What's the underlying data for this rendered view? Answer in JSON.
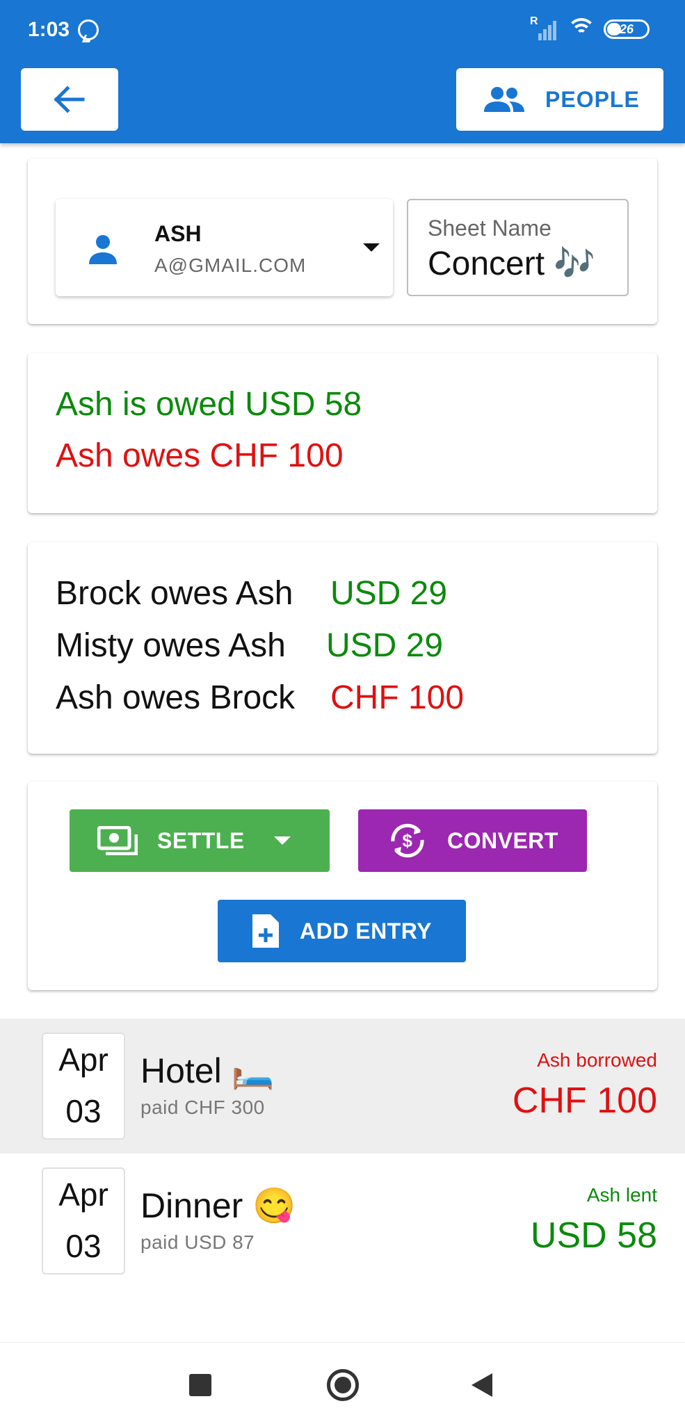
{
  "status_bar": {
    "time": "1:03",
    "signal_label": "R",
    "battery": "26",
    "icons": [
      "whatsapp-icon",
      "signal-icon",
      "wifi-icon",
      "battery-icon"
    ]
  },
  "app_bar": {
    "back_icon": "arrow-left-icon",
    "people_label": "PEOPLE",
    "people_icon": "people-icon",
    "color": "#1976d2"
  },
  "selector": {
    "user_name": "ASH",
    "user_email": "A@GMAIL.COM",
    "user_icon": "person-icon",
    "sheet_label": "Sheet Name",
    "sheet_value": "Concert 🎶"
  },
  "summary": {
    "owed": "Ash is owed USD 58",
    "owes": "Ash owes CHF 100"
  },
  "debts": [
    {
      "text": "Brock owes Ash",
      "amount": "USD 29",
      "status": "green"
    },
    {
      "text": "Misty owes Ash",
      "amount": "USD 29",
      "status": "green"
    },
    {
      "text": "Ash owes Brock",
      "amount": "CHF 100",
      "status": "red"
    }
  ],
  "actions": {
    "settle": "SETTLE",
    "convert": "CONVERT",
    "add_entry": "ADD ENTRY",
    "settle_color": "#4caf50",
    "convert_color": "#9c27b0",
    "add_color": "#1976d2"
  },
  "entries": [
    {
      "month": "Apr",
      "day": "03",
      "title": "Hotel 🛏️",
      "paid": "paid CHF 300",
      "role": "Ash borrowed",
      "amount": "CHF 100",
      "status": "red"
    },
    {
      "month": "Apr",
      "day": "03",
      "title": "Dinner 😋",
      "paid": "paid USD 87",
      "role": "Ash lent",
      "amount": "USD 58",
      "status": "green"
    }
  ],
  "colors": {
    "positive": "#0b8a0b",
    "negative": "#e01010"
  }
}
